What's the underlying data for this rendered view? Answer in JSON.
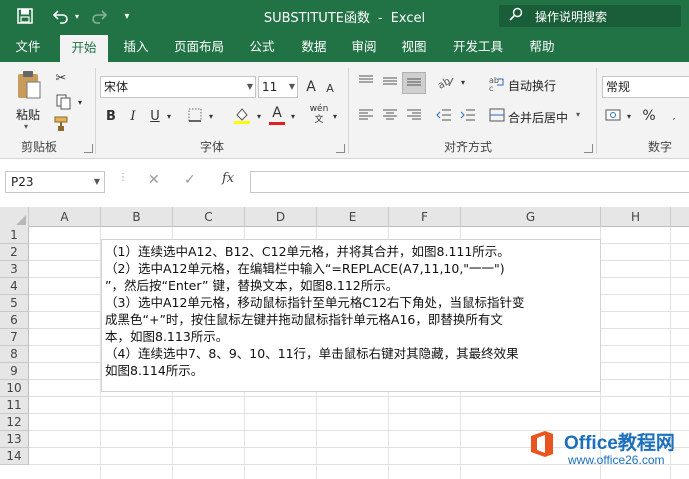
{
  "titlebar": {
    "save_icon": "save-icon",
    "undo_icon": "undo-icon",
    "redo_icon": "redo-icon",
    "customize_icon": "customize-qat-icon",
    "workbook_name": "SUBSTITUTE函数",
    "separator": "-",
    "app_name": "Excel",
    "tell_me": "操作说明搜索",
    "colors": {
      "bar": "#217346",
      "tellme_bg": "#1a5e39"
    }
  },
  "tabs": [
    "文件",
    "开始",
    "插入",
    "页面布局",
    "公式",
    "数据",
    "审阅",
    "视图",
    "开发工具",
    "帮助"
  ],
  "active_tab": "开始",
  "ribbon": {
    "clipboard": {
      "label": "剪贴板",
      "paste": "粘贴"
    },
    "font": {
      "label": "字体",
      "name": "宋体",
      "size": "11",
      "bold": "B",
      "italic": "I",
      "underline": "U",
      "grow": "A",
      "shrink": "A",
      "font_color": "A",
      "phonetic": "wén"
    },
    "alignment": {
      "label": "对齐方式",
      "wrap": "自动换行",
      "merge": "合并后居中"
    },
    "number": {
      "label": "数字",
      "format": "常规",
      "percent": "%"
    }
  },
  "formula_bar": {
    "name_box": "P23",
    "fx": "fx",
    "value": ""
  },
  "columns": [
    "A",
    "B",
    "C",
    "D",
    "E",
    "F",
    "G",
    "H"
  ],
  "rows": [
    "1",
    "2",
    "3",
    "4",
    "5",
    "6",
    "7",
    "8",
    "9",
    "10",
    "11",
    "12",
    "13",
    "14"
  ],
  "merged_cell_lines": [
    "（1）连续选中A12、B12、C12单元格，并将其合并，如图8.111所示。",
    "（2）选中A12单元格，在编辑栏中输入“=REPLACE(A7,11,10,\"一一\")",
    "”，然后按“Enter” 键，替换文本，如图8.112所示。",
    "（3）选中A12单元格，移动鼠标指针至单元格C12右下角处，当鼠标指针变",
    "成黑色“+”时，按住鼠标左键并拖动鼠标指针单元格A16，即替换所有文",
    "本，如图8.113所示。",
    "（4）连续选中7、8、9、10、11行，单击鼠标右键对其隐藏，其最终效果",
    "如图8.114所示。"
  ],
  "watermark": {
    "title": "Office教程网",
    "url": "www.office26.com"
  }
}
